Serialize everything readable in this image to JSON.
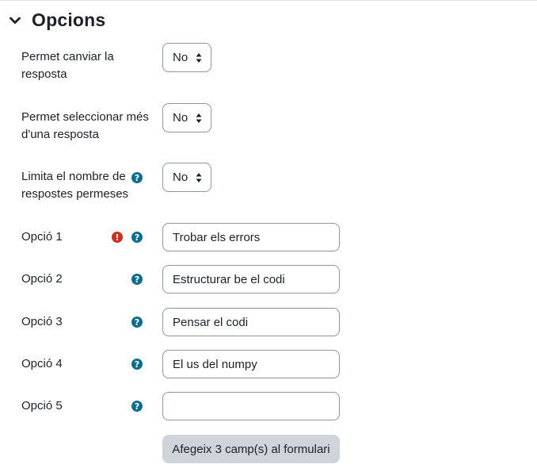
{
  "section": {
    "title": "Opcions",
    "expanded": true
  },
  "settings": [
    {
      "label_line1": "Permet canviar la",
      "label_line2": "resposta",
      "value": "No"
    },
    {
      "label_line1": "Permet seleccionar més",
      "label_line2": "d'una resposta",
      "value": "No"
    },
    {
      "label_line1": "Limita el nombre de",
      "label_line2": "respostes permeses",
      "value": "No",
      "has_help": true
    }
  ],
  "options": [
    {
      "label": "Opció 1",
      "value": "Trobar els errors",
      "has_error": true,
      "has_help": true
    },
    {
      "label": "Opció 2",
      "value": "Estructurar be el codi",
      "has_help": true
    },
    {
      "label": "Opció 3",
      "value": "Pensar el codi",
      "has_help": true
    },
    {
      "label": "Opció 4",
      "value": "El us del numpy",
      "has_help": true
    },
    {
      "label": "Opció 5",
      "value": "",
      "has_help": true
    }
  ],
  "add_button": {
    "label": "Afegeix 3 camp(s) al formulari"
  },
  "icons": {
    "help": "question-circle-icon",
    "error": "exclamation-circle-icon",
    "collapse": "chevron-down-icon",
    "select": "select-arrows-icon"
  },
  "colors": {
    "help": "#0f6c8c",
    "error": "#ca3120",
    "button_bg": "#ced4da",
    "border": "#8f959e"
  }
}
